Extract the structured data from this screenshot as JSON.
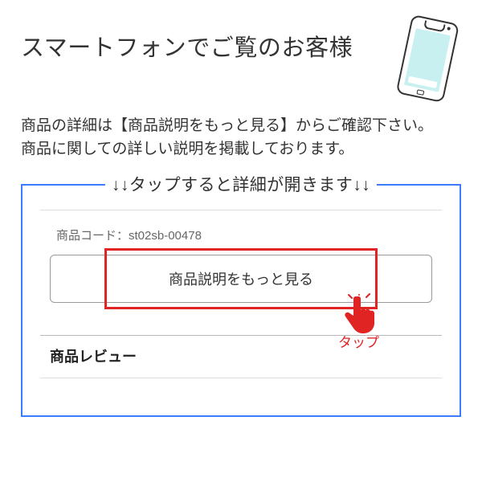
{
  "header": {
    "title": "スマートフォンでご覧のお客様"
  },
  "description": {
    "line1": "商品の詳細は【商品説明をもっと見る】からご確認下さい。",
    "line2": "商品に関しての詳しい説明を掲載しております。"
  },
  "callout": {
    "legend": "↓↓タップすると詳細が開きます↓↓",
    "product_code_label": "商品コード：",
    "product_code_value": "st02sb-00478",
    "expand_button_label": "商品説明をもっと見る",
    "tap_label": "タップ",
    "review_heading": "商品レビュー"
  }
}
